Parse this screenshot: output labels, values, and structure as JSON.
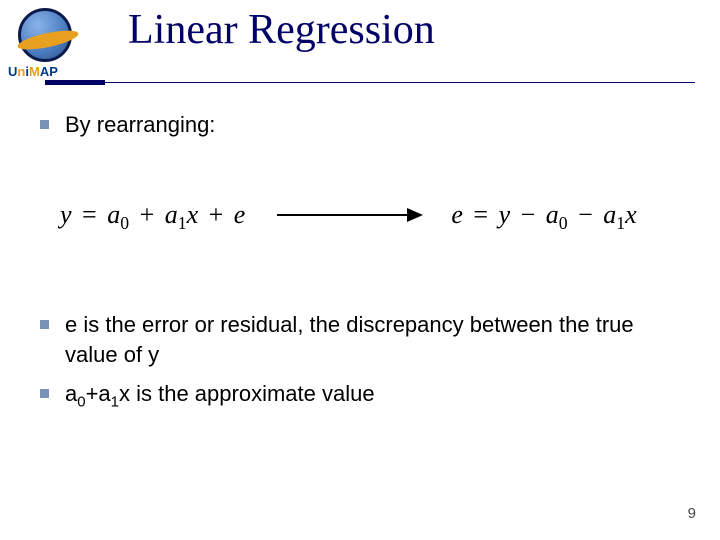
{
  "logo": {
    "text_u": "U",
    "text_n": "n",
    "text_i": "i",
    "text_m": "M",
    "text_a": "A",
    "text_p": "P"
  },
  "title": "Linear Regression",
  "bullets": {
    "b1": "By rearranging:",
    "b2": "e is the error or residual, the discrepancy between the true value of y",
    "b3_prefix": "a",
    "b3_sub0": "0",
    "b3_mid1": "+a",
    "b3_sub1": "1",
    "b3_suffix": "x is the approximate value"
  },
  "equations": {
    "left": {
      "y": "y",
      "eq": "=",
      "a": "a",
      "s0": "0",
      "plus1": "+",
      "a2": "a",
      "s1": "1",
      "x": "x",
      "plus2": "+",
      "e": "e"
    },
    "right": {
      "e": "e",
      "eq": "=",
      "y": "y",
      "minus1": "−",
      "a": "a",
      "s0": "0",
      "minus2": "−",
      "a2": "a",
      "s1": "1",
      "x": "x"
    }
  },
  "page_number": "9"
}
